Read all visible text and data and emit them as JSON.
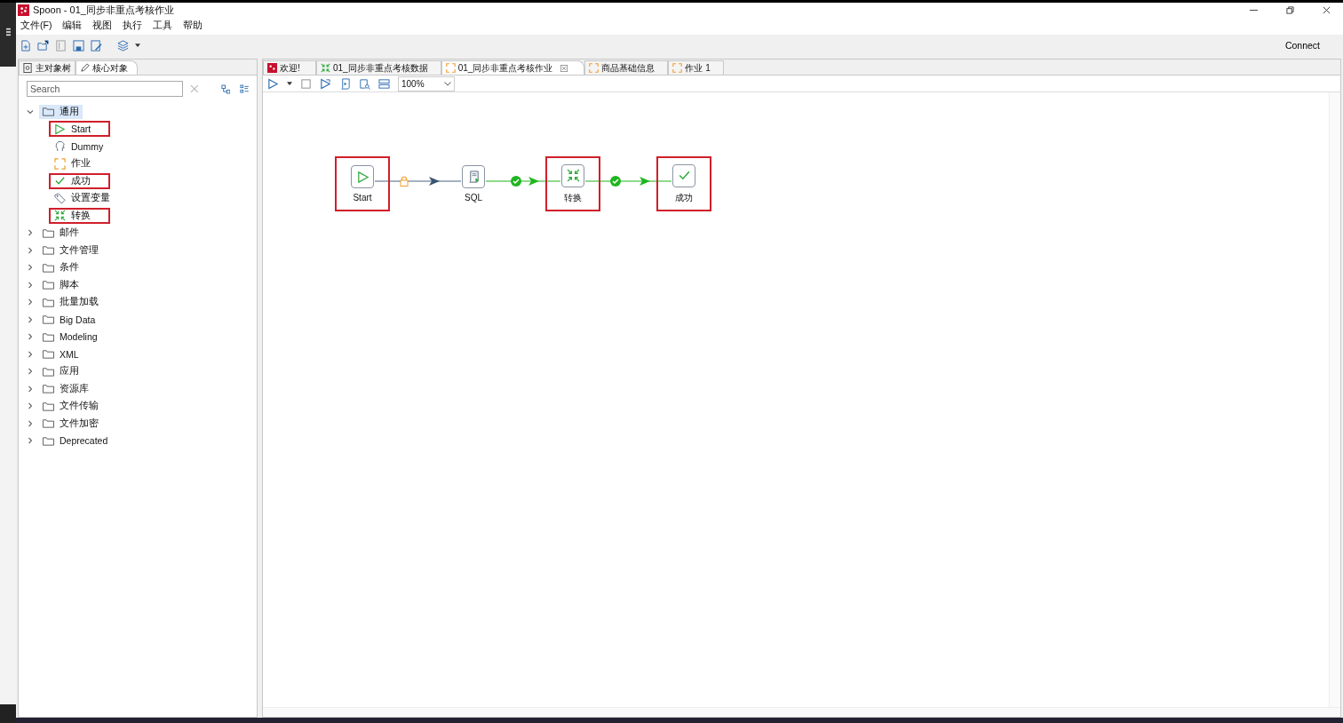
{
  "window": {
    "title": "Spoon - 01_同步非重点考核作业"
  },
  "menu": [
    "文件(F)",
    "编辑",
    "视图",
    "执行",
    "工具",
    "帮助"
  ],
  "toolbar": {
    "connect": "Connect"
  },
  "left_tabs": [
    {
      "label": "主对象树",
      "kind": "tree",
      "selected": false
    },
    {
      "label": "核心对象",
      "kind": "pencil",
      "selected": true
    }
  ],
  "search": {
    "placeholder": "Search"
  },
  "tree": [
    {
      "label": "通用",
      "expanded": true,
      "selected": true,
      "children": [
        {
          "label": "Start",
          "kind": "start",
          "highlighted": true
        },
        {
          "label": "Dummy",
          "kind": "dummy",
          "highlighted": false
        },
        {
          "label": "作业",
          "kind": "job",
          "highlighted": false
        },
        {
          "label": "成功",
          "kind": "success",
          "highlighted": true
        },
        {
          "label": "设置变量",
          "kind": "variable",
          "highlighted": false
        },
        {
          "label": "转换",
          "kind": "transform",
          "highlighted": true
        }
      ]
    },
    {
      "label": "邮件",
      "expanded": false,
      "selected": false
    },
    {
      "label": "文件管理",
      "expanded": false,
      "selected": false
    },
    {
      "label": "条件",
      "expanded": false,
      "selected": false
    },
    {
      "label": "脚本",
      "expanded": false,
      "selected": false
    },
    {
      "label": "批量加载",
      "expanded": false,
      "selected": false
    },
    {
      "label": "Big Data",
      "expanded": false,
      "selected": false
    },
    {
      "label": "Modeling",
      "expanded": false,
      "selected": false
    },
    {
      "label": "XML",
      "expanded": false,
      "selected": false
    },
    {
      "label": "应用",
      "expanded": false,
      "selected": false
    },
    {
      "label": "资源库",
      "expanded": false,
      "selected": false
    },
    {
      "label": "文件传输",
      "expanded": false,
      "selected": false
    },
    {
      "label": "文件加密",
      "expanded": false,
      "selected": false
    },
    {
      "label": "Deprecated",
      "expanded": false,
      "selected": false
    }
  ],
  "editor_tabs": [
    {
      "label": "欢迎!",
      "kind": "welcome",
      "selected": false
    },
    {
      "label": "01_同步非重点考核数据",
      "kind": "transform",
      "selected": false
    },
    {
      "label": "01_同步非重点考核作业",
      "kind": "job",
      "selected": true
    },
    {
      "label": "商品基础信息",
      "kind": "job",
      "selected": false
    },
    {
      "label": "作业 1",
      "kind": "job",
      "selected": false
    }
  ],
  "zoom": {
    "value": "100%"
  },
  "canvas": {
    "nodes": [
      {
        "label": "Start",
        "kind": "start",
        "highlighted": true
      },
      {
        "label": "SQL",
        "kind": "sql",
        "highlighted": false
      },
      {
        "label": "转换",
        "kind": "transform",
        "highlighted": true
      },
      {
        "label": "成功",
        "kind": "success",
        "highlighted": true
      }
    ],
    "hops": [
      {
        "kind": "unconditional"
      },
      {
        "kind": "success"
      },
      {
        "kind": "success"
      }
    ]
  }
}
